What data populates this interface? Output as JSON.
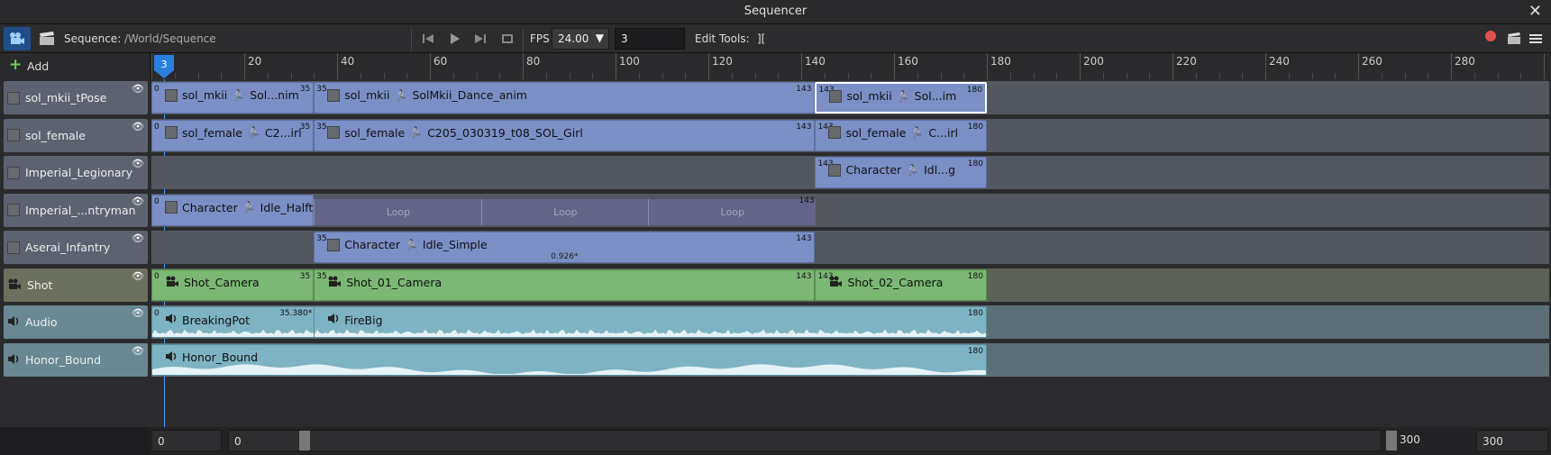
{
  "window": {
    "title": "Sequencer"
  },
  "toolbar": {
    "sequence_label": "Sequence:",
    "sequence_path": "/World/Sequence",
    "fps_label": "FPS",
    "fps_value": "24.00",
    "frame_value": "3",
    "edit_tools_label": "Edit Tools:",
    "edit_tools_icon": "][",
    "accent_color": "#3ea0ff"
  },
  "timeline": {
    "add_label": "Add",
    "current_frame": "3",
    "ruler_labels": [
      "20",
      "40",
      "60",
      "80",
      "100",
      "120",
      "140",
      "160",
      "180",
      "200",
      "220",
      "240",
      "260",
      "280"
    ]
  },
  "tracks": [
    {
      "name": "sol_mkii_tPose",
      "clips": [
        {
          "start": "0",
          "end": "35",
          "a": "sol_mkii",
          "b": "Sol...nim"
        },
        {
          "start": "35",
          "end": "143",
          "a": "sol_mkii",
          "b": "SolMkii_Dance_anim"
        },
        {
          "start": "143",
          "end": "180",
          "a": "sol_mkii",
          "b": "Sol...im"
        }
      ]
    },
    {
      "name": "sol_female",
      "clips": [
        {
          "start": "0",
          "end": "35",
          "a": "sol_female",
          "b": "C2...irl"
        },
        {
          "start": "35",
          "end": "143",
          "a": "sol_female",
          "b": "C205_030319_t08_SOL_Girl"
        },
        {
          "start": "143",
          "end": "180",
          "a": "sol_female",
          "b": "C...irl"
        }
      ]
    },
    {
      "name": "Imperial_Legionary",
      "clips": [
        {
          "start": "143",
          "end": "180",
          "a": "Character",
          "b": "Idl...g"
        }
      ]
    },
    {
      "name": "Imperial_...ntryman",
      "clips": [
        {
          "start": "0",
          "end": "143",
          "a": "Character",
          "b": "Idle_Halfturn",
          "loop": "Loop"
        }
      ]
    },
    {
      "name": "Aserai_Infantry",
      "clips": [
        {
          "start": "35",
          "end": "143",
          "a": "Character",
          "b": "Idle_Simple",
          "speed": "0.926*"
        }
      ]
    },
    {
      "name": "Shot",
      "clips": [
        {
          "start": "0",
          "end": "35",
          "a": "Shot_Camera"
        },
        {
          "start": "35",
          "end": "143",
          "a": "Shot_01_Camera"
        },
        {
          "start": "143",
          "end": "180",
          "a": "Shot_02_Camera"
        }
      ]
    },
    {
      "name": "Audio",
      "clips": [
        {
          "start": "0",
          "end": "35.380*",
          "a": "BreakingPot"
        },
        {
          "end": "180",
          "a": "FireBig"
        }
      ]
    },
    {
      "name": "Honor_Bound",
      "clips": [
        {
          "end": "180",
          "a": "Honor_Bound"
        }
      ]
    }
  ],
  "range": {
    "start": "0",
    "view_start": "0",
    "view_end": "300",
    "end": "300"
  }
}
